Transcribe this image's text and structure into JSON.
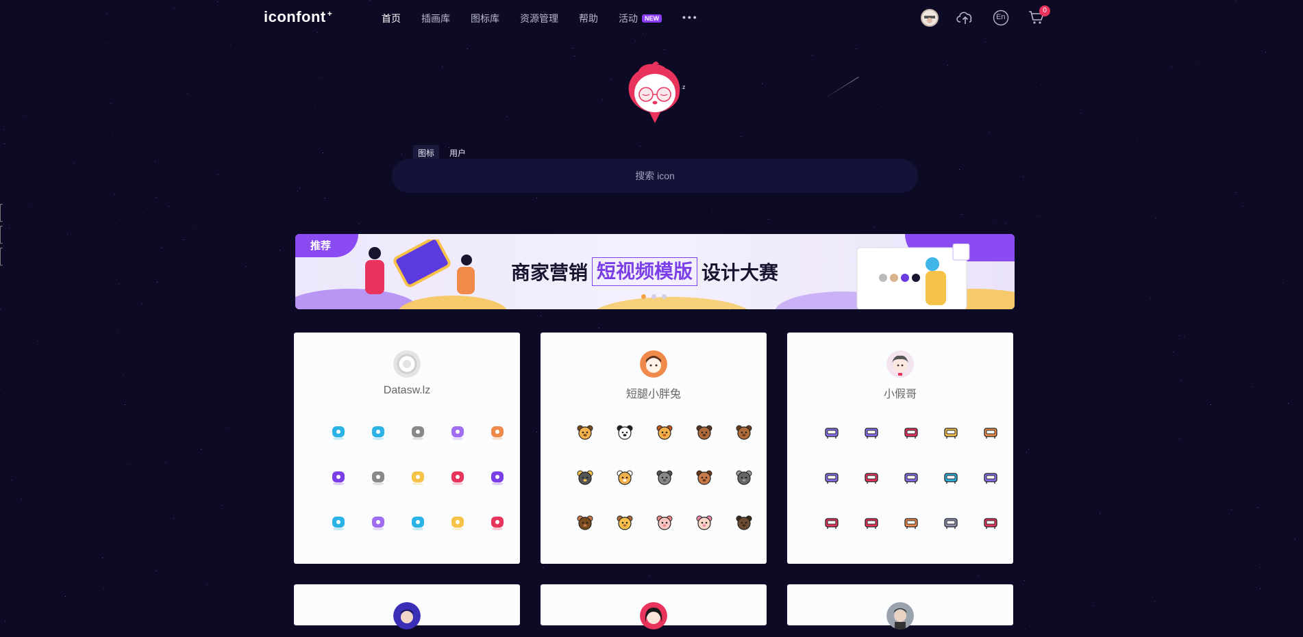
{
  "header": {
    "logo": "iconfont",
    "logo_plus": "+",
    "nav": [
      {
        "label": "首页",
        "active": true
      },
      {
        "label": "插画库"
      },
      {
        "label": "图标库"
      },
      {
        "label": "资源管理"
      },
      {
        "label": "帮助"
      },
      {
        "label": "活动",
        "badge": "NEW"
      }
    ],
    "more": "•••",
    "icons": [
      "avatar",
      "upload-cloud-icon",
      "language-en-icon",
      "cart-icon"
    ],
    "cart_count": "0",
    "lang_label": "En"
  },
  "search": {
    "tabs": [
      "图标",
      "用户"
    ],
    "active_tab": "图标",
    "placeholder": "搜索 icon"
  },
  "banner": {
    "tag": "推荐",
    "title_before": "商家营销",
    "title_highlight": "短视频模版",
    "title_after": "设计大赛",
    "dots": 3,
    "active_dot": 0
  },
  "cards": [
    {
      "name": "Datasw.lz",
      "icon_style": "rounded-color"
    },
    {
      "name": "短腿小胖兔",
      "icon_style": "animal-faces"
    },
    {
      "name": "小假哥",
      "icon_style": "furniture-lineal"
    },
    {
      "name": "",
      "icon_style": ""
    },
    {
      "name": "",
      "icon_style": ""
    },
    {
      "name": "",
      "icon_style": ""
    }
  ],
  "colors": {
    "background": "#0c0a24",
    "accent": "#8b3cf6",
    "badge_red": "#e8335c",
    "mascot_pink": "#e8335c"
  }
}
